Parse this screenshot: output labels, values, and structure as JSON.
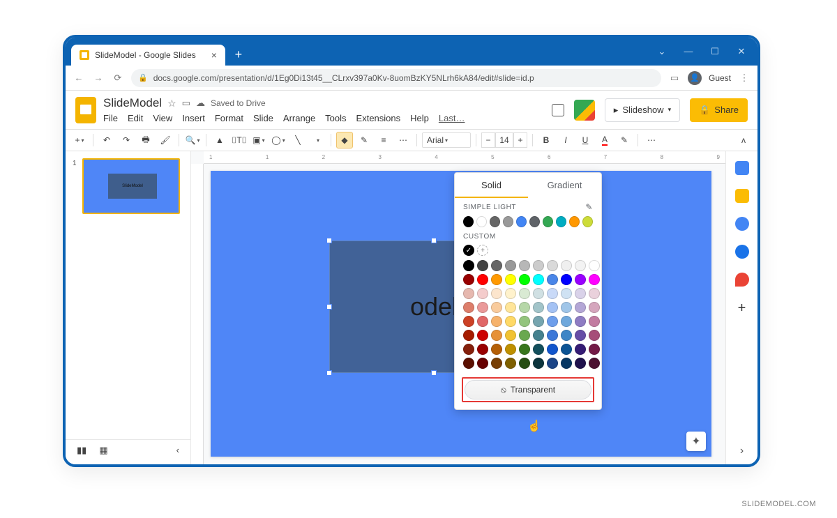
{
  "browser": {
    "tab_title": "SlideModel - Google Slides",
    "url": "docs.google.com/presentation/d/1Eg0Di13t45__CLrxv397a0Kv-8uomBzKY5NLrh6kA84/edit#slide=id.p",
    "guest_label": "Guest"
  },
  "header": {
    "doc_title": "SlideModel",
    "saved_status": "Saved to Drive",
    "menus": [
      "File",
      "Edit",
      "View",
      "Insert",
      "Format",
      "Slide",
      "Arrange",
      "Tools",
      "Extensions",
      "Help",
      "Last…"
    ],
    "slideshow_label": "Slideshow",
    "share_label": "Share"
  },
  "toolbar": {
    "font_name": "Arial",
    "font_size": "14"
  },
  "thumbnail": {
    "number": "1",
    "shape_text": "SlideModel"
  },
  "slide": {
    "shape_text": "odel"
  },
  "ruler_ticks": [
    "1",
    "1",
    "2",
    "3",
    "4",
    "5",
    "6",
    "7",
    "8",
    "9"
  ],
  "color_picker": {
    "tabs": {
      "solid": "Solid",
      "gradient": "Gradient"
    },
    "section_theme": "SIMPLE LIGHT",
    "section_custom": "CUSTOM",
    "transparent_label": "Transparent",
    "theme_colors": [
      "#000000",
      "#ffffff",
      "#666666",
      "#999999",
      "#4285f4",
      "#5f6368",
      "#34a853",
      "#00acc1",
      "#ff9800",
      "#cddc39"
    ],
    "custom_selected": "#000000",
    "palette": [
      [
        "#000000",
        "#434343",
        "#666666",
        "#999999",
        "#b7b7b7",
        "#cccccc",
        "#d9d9d9",
        "#efefef",
        "#f3f3f3",
        "#ffffff"
      ],
      [
        "#980000",
        "#ff0000",
        "#ff9900",
        "#ffff00",
        "#00ff00",
        "#00ffff",
        "#4a86e8",
        "#0000ff",
        "#9900ff",
        "#ff00ff"
      ],
      [
        "#e6b8af",
        "#f4cccc",
        "#fce5cd",
        "#fff2cc",
        "#d9ead3",
        "#d0e0e3",
        "#c9daf8",
        "#cfe2f3",
        "#d9d2e9",
        "#ead1dc"
      ],
      [
        "#dd7e6b",
        "#ea9999",
        "#f9cb9c",
        "#ffe599",
        "#b6d7a8",
        "#a2c4c9",
        "#a4c2f4",
        "#9fc5e8",
        "#b4a7d6",
        "#d5a6bd"
      ],
      [
        "#cc4125",
        "#e06666",
        "#f6b26b",
        "#ffd966",
        "#93c47d",
        "#76a5af",
        "#6d9eeb",
        "#6fa8dc",
        "#8e7cc3",
        "#c27ba0"
      ],
      [
        "#a61c00",
        "#cc0000",
        "#e69138",
        "#f1c232",
        "#6aa84f",
        "#45818e",
        "#3c78d8",
        "#3d85c6",
        "#674ea7",
        "#a64d79"
      ],
      [
        "#85200c",
        "#990000",
        "#b45f06",
        "#bf9000",
        "#38761d",
        "#134f5c",
        "#1155cc",
        "#0b5394",
        "#351c75",
        "#741b47"
      ],
      [
        "#5b0f00",
        "#660000",
        "#783f04",
        "#7f6000",
        "#274e13",
        "#0c343d",
        "#1c4587",
        "#073763",
        "#20124d",
        "#4c1130"
      ]
    ]
  },
  "watermark": "SLIDEMODEL.COM"
}
